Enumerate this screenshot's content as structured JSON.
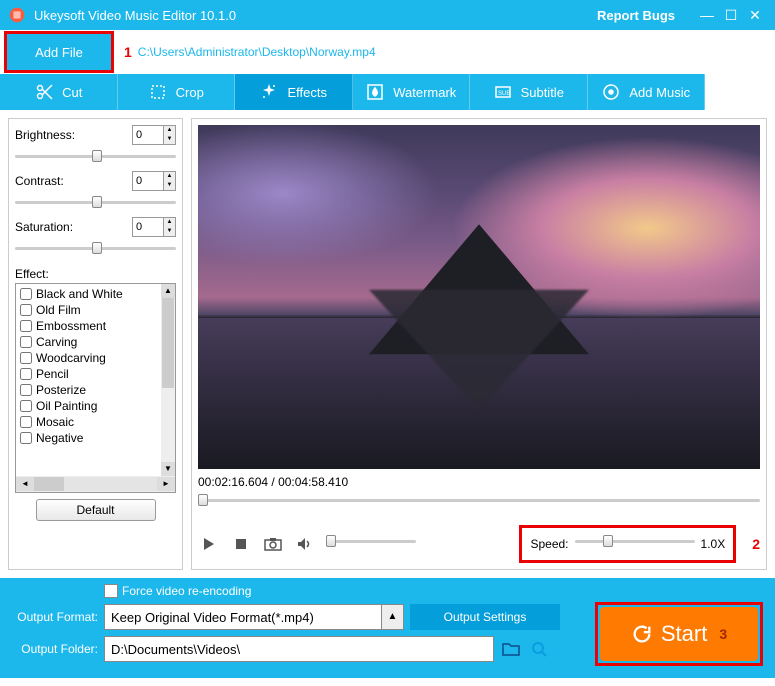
{
  "titlebar": {
    "title": "Ukeysoft Video Music Editor 10.1.0",
    "report": "Report Bugs"
  },
  "filebar": {
    "add_file": "Add File",
    "annotation1": "1",
    "path": "C:\\Users\\Administrator\\Desktop\\Norway.mp4"
  },
  "tabs": {
    "cut": "Cut",
    "crop": "Crop",
    "effects": "Effects",
    "watermark": "Watermark",
    "subtitle": "Subtitle",
    "addmusic": "Add Music"
  },
  "left": {
    "brightness_label": "Brightness:",
    "brightness_value": "0",
    "contrast_label": "Contrast:",
    "contrast_value": "0",
    "saturation_label": "Saturation:",
    "saturation_value": "0",
    "effect_label": "Effect:",
    "effects": [
      "Black and White",
      "Old Film",
      "Embossment",
      "Carving",
      "Woodcarving",
      "Pencil",
      "Posterize",
      "Oil Painting",
      "Mosaic",
      "Negative"
    ],
    "default": "Default"
  },
  "preview": {
    "timecode": "00:02:16.604 / 00:04:58.410",
    "speed_label": "Speed:",
    "speed_value": "1.0X",
    "annotation2": "2"
  },
  "bottom": {
    "force": "Force video re-encoding",
    "format_label": "Output Format:",
    "format_value": "Keep Original Video Format(*.mp4)",
    "output_settings": "Output Settings",
    "folder_label": "Output Folder:",
    "folder_value": "D:\\Documents\\Videos\\",
    "start": "Start",
    "annotation3": "3"
  }
}
